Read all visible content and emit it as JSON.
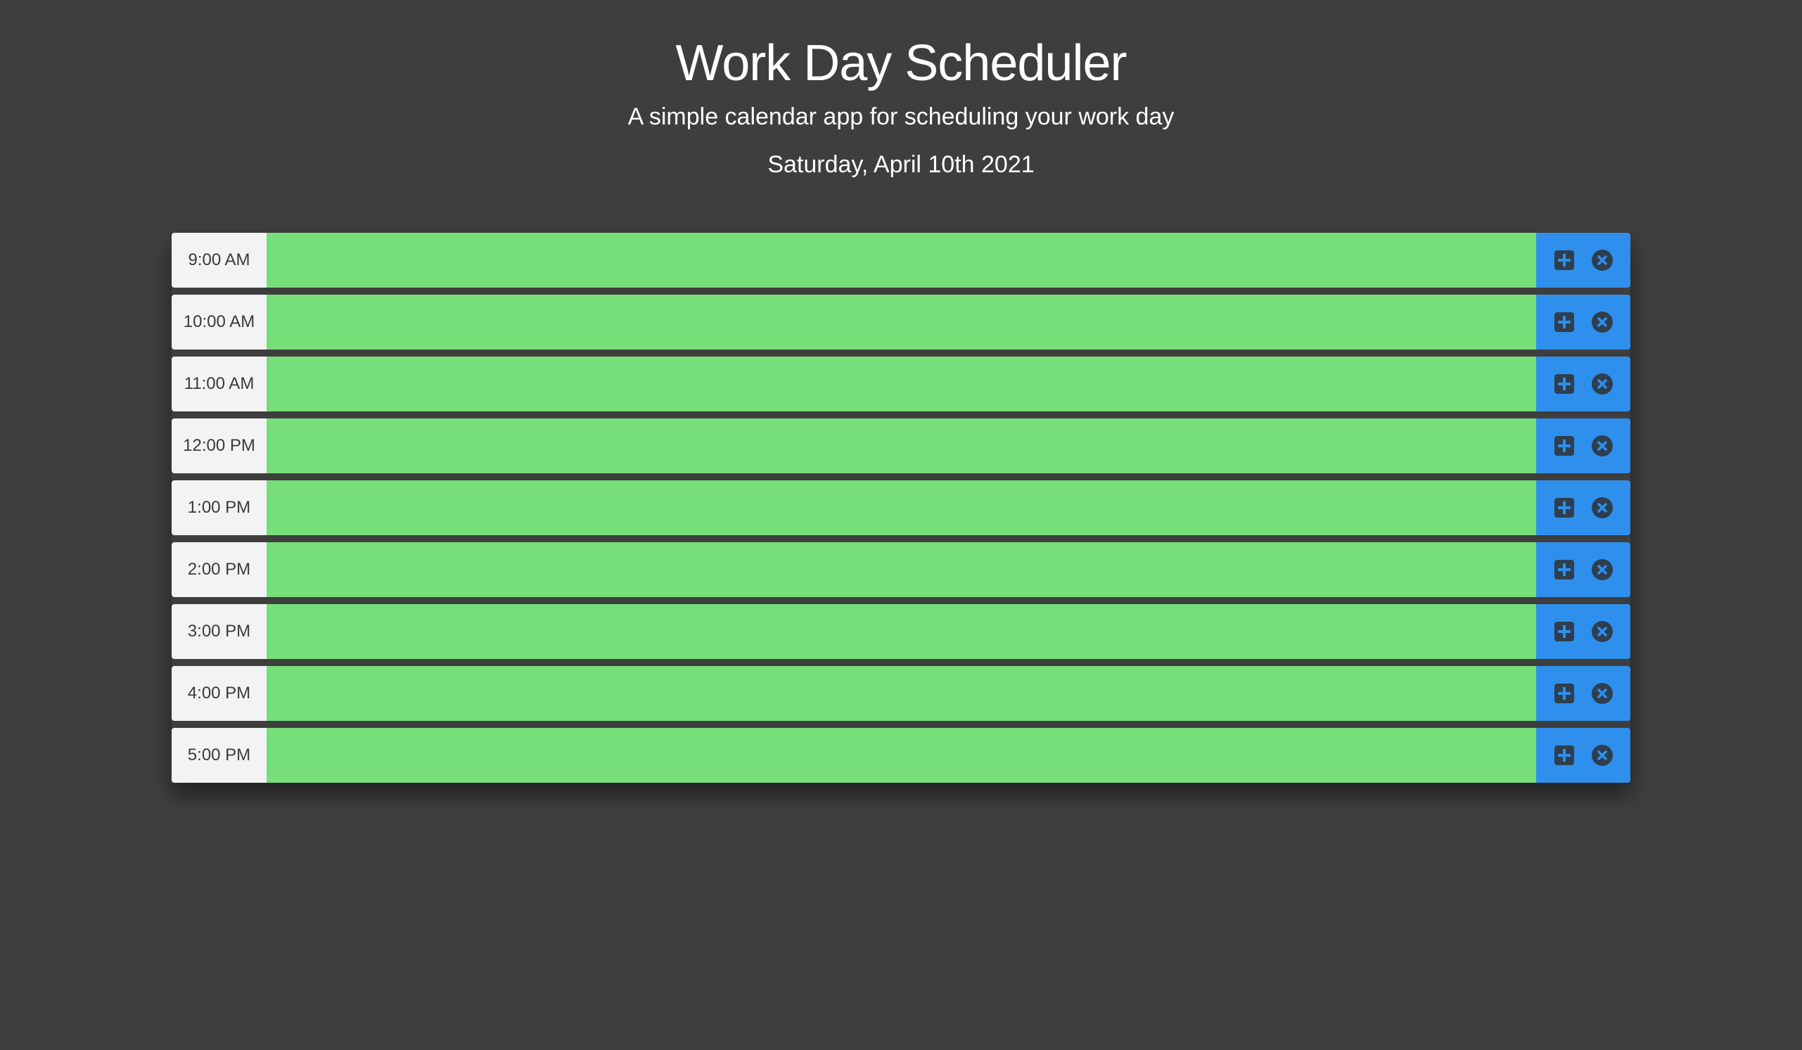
{
  "header": {
    "title": "Work Day Scheduler",
    "subtitle": "A simple calendar app for scheduling your work day",
    "date": "Saturday, April 10th 2021"
  },
  "colors": {
    "background": "#3e3e3e",
    "hour_cell": "#f3f3f3",
    "future_row": "#77df7a",
    "action_cell": "#2e90ec",
    "icon": "#2f3e4e"
  },
  "icons": {
    "add": "plus-square-icon",
    "remove": "close-circle-icon"
  },
  "rows": [
    {
      "hour": "9:00 AM",
      "task": ""
    },
    {
      "hour": "10:00 AM",
      "task": ""
    },
    {
      "hour": "11:00 AM",
      "task": ""
    },
    {
      "hour": "12:00 PM",
      "task": ""
    },
    {
      "hour": "1:00 PM",
      "task": ""
    },
    {
      "hour": "2:00 PM",
      "task": ""
    },
    {
      "hour": "3:00 PM",
      "task": ""
    },
    {
      "hour": "4:00 PM",
      "task": ""
    },
    {
      "hour": "5:00 PM",
      "task": ""
    }
  ]
}
